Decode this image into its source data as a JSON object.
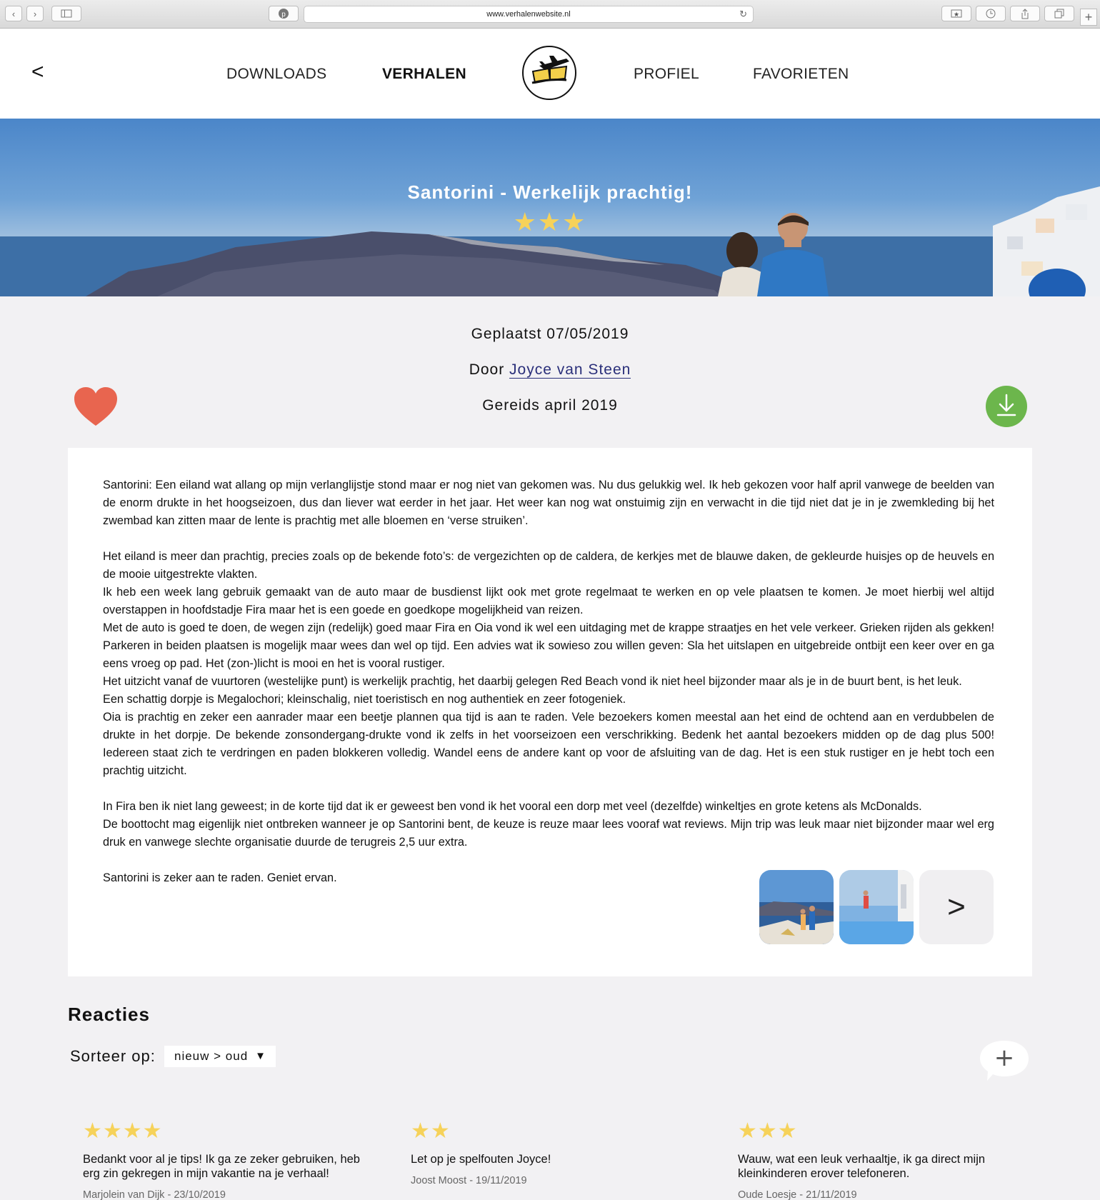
{
  "browser": {
    "url": "www.verhalenwebsite.nl",
    "back_glyph": "‹",
    "forward_glyph": "›",
    "reload_glyph": "↻",
    "plus_glyph": "+"
  },
  "header": {
    "back_glyph": "<",
    "nav": [
      "DOWNLOADS",
      "VERHALEN",
      "PROFIEL",
      "FAVORIETEN"
    ],
    "active_nav": "VERHALEN"
  },
  "hero": {
    "title": "Santorini - Werkelijk prachtig!",
    "stars": "★★★",
    "rating": 3
  },
  "meta": {
    "posted": "Geplaatst 07/05/2019",
    "by_prefix": "Door ",
    "author": "Joyce van Steen",
    "traveled": "Gereids april 2019"
  },
  "colors": {
    "heart": "#e8654f",
    "download": "#6cb64c",
    "star": "#f6d25a",
    "author_link": "#2a2f7a"
  },
  "article": {
    "paragraphs": [
      "Santorini: Een eiland wat allang op mijn verlanglijstje stond maar er nog niet van gekomen was. Nu dus gelukkig wel. Ik heb gekozen voor half april vanwege de beelden van de enorm drukte in het hoogseizoen, dus dan liever wat eerder in het jaar. Het weer kan nog wat onstuimig zijn en verwacht in die tijd niet dat je in je zwemkleding bij het zwembad kan zitten maar de lente is prachtig met alle bloemen en ‘verse struiken’.",
      "",
      "Het eiland is meer dan prachtig, precies zoals op de bekende foto’s: de vergezichten op de caldera, de kerkjes met de blauwe daken, de gekleurde huisjes op de heuvels en de mooie uitgestrekte vlakten.",
      "Ik heb een week lang gebruik gemaakt van de auto maar de busdienst lijkt ook met grote regelmaat te werken en op vele plaatsen te komen. Je moet hierbij wel altijd overstappen in hoofdstadje Fira maar het is een goede en goedkope mogelijkheid van reizen.",
      "Met de auto is goed te doen, de wegen zijn (redelijk) goed maar Fira en Oia vond ik wel een uitdaging met de krappe straatjes en het vele verkeer. Grieken rijden als gekken! Parkeren in beiden plaatsen is mogelijk maar wees dan wel op tijd. Een advies wat ik sowieso zou willen geven: Sla het uitslapen en uitgebreide ontbijt een keer over en ga eens vroeg op pad. Het (zon-)licht is mooi en het is vooral rustiger.",
      "Het uitzicht vanaf de vuurtoren (westelijke punt) is werkelijk prachtig, het daarbij gelegen Red Beach vond ik niet heel bijzonder maar als je in de buurt bent, is het leuk.",
      "Een schattig dorpje is Megalochori; kleinschalig, niet toeristisch en nog authentiek en zeer fotogeniek.",
      "Oia is prachtig en zeker een aanrader maar een beetje plannen qua tijd is aan te raden. Vele bezoekers komen meestal aan het eind de ochtend aan en verdubbelen de drukte in het dorpje. De bekende zonsondergang-drukte vond ik zelfs in het voorseizoen een verschrikking. Bedenk het aantal bezoekers midden op de dag plus 500! Iedereen staat zich te verdringen en paden blokkeren volledig. Wandel eens de andere kant op voor de afsluiting van de dag. Het is een stuk rustiger en je hebt toch een prachtig uitzicht.",
      "",
      "In Fira ben ik niet lang geweest; in de korte tijd dat ik er geweest ben vond ik het vooral een dorp met veel (dezelfde) winkeltjes en grote ketens als McDonalds.",
      "De boottocht mag eigenlijk niet ontbreken wanneer je op Santorini bent, de keuze is reuze maar lees vooraf wat reviews. Mijn trip was leuk maar niet bijzonder maar wel erg druk en vanwege slechte organisatie duurde de terugreis 2,5 uur extra.",
      "",
      "Santorini is zeker aan te raden. Geniet ervan."
    ],
    "gallery_next": ">"
  },
  "reactions": {
    "heading": "Reacties",
    "sort_label": "Sorteer op:",
    "sort_value": "nieuw > oud",
    "add_glyph": "+",
    "items": [
      {
        "stars": "★★★★",
        "rating": 4,
        "text": "Bedankt voor al je tips! Ik ga ze zeker gebruiken, heb erg zin gekregen in mijn vakantie na je verhaal!",
        "by": "Marjolein van Dijk - 23/10/2019"
      },
      {
        "stars": "★★",
        "rating": 2,
        "text": "Let op je spelfouten Joyce!",
        "by": "Joost Moost - 19/11/2019"
      },
      {
        "stars": "★★★",
        "rating": 3,
        "text": "Wauw, wat een leuk verhaaltje, ik ga direct mijn kleinkinderen erover telefoneren.",
        "by": "Oude Loesje - 21/11/2019"
      }
    ]
  }
}
